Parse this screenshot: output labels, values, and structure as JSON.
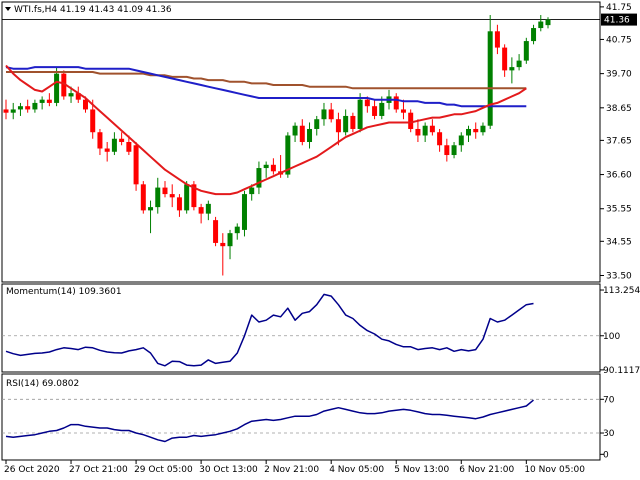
{
  "symbol_header": "WTI.fs,H4  41.19 41.43 41.09 41.36",
  "current_price_label": "41.36",
  "colors": {
    "bull": "#008000",
    "bear": "#ff0000",
    "ma_fast": "#e31a1c",
    "ma_mid": "#1f1fc8",
    "ma_slow": "#a0522d",
    "indicator_line": "#00008b",
    "price_tag_bg": "#000000"
  },
  "momentum": {
    "label": "Momentum(14) 109.3601",
    "axis_labels": [
      "113.2541",
      "100",
      "90.1117"
    ]
  },
  "rsi": {
    "label": "RSI(14) 69.0802",
    "axis_labels": [
      "70",
      "30",
      "0"
    ]
  },
  "price_axis_labels": [
    "41.75",
    "40.75",
    "39.70",
    "38.65",
    "37.65",
    "36.60",
    "35.55",
    "34.55",
    "33.50"
  ],
  "time_axis_labels": [
    "26 Oct 2020",
    "27 Oct 21:00",
    "29 Oct 05:00",
    "30 Oct 13:00",
    "2 Nov 21:00",
    "4 Nov 05:00",
    "5 Nov 13:00",
    "6 Nov 21:00",
    "10 Nov 05:00"
  ],
  "chart_data": [
    {
      "type": "candlestick",
      "ylim": [
        33.3,
        41.9
      ],
      "candles": [
        {
          "o": 38.6,
          "h": 38.9,
          "l": 38.3,
          "c": 38.5
        },
        {
          "o": 38.5,
          "h": 38.8,
          "l": 38.3,
          "c": 38.6
        },
        {
          "o": 38.6,
          "h": 38.8,
          "l": 38.4,
          "c": 38.7
        },
        {
          "o": 38.7,
          "h": 38.9,
          "l": 38.5,
          "c": 38.6
        },
        {
          "o": 38.6,
          "h": 38.9,
          "l": 38.5,
          "c": 38.8
        },
        {
          "o": 38.8,
          "h": 39.0,
          "l": 38.6,
          "c": 38.9
        },
        {
          "o": 38.9,
          "h": 39.1,
          "l": 38.7,
          "c": 38.8
        },
        {
          "o": 38.8,
          "h": 39.9,
          "l": 38.7,
          "c": 39.7
        },
        {
          "o": 39.7,
          "h": 39.8,
          "l": 38.9,
          "c": 39.0
        },
        {
          "o": 39.0,
          "h": 39.3,
          "l": 38.8,
          "c": 39.1
        },
        {
          "o": 39.1,
          "h": 39.3,
          "l": 38.8,
          "c": 38.9
        },
        {
          "o": 38.9,
          "h": 39.0,
          "l": 38.5,
          "c": 38.6
        },
        {
          "o": 38.6,
          "h": 38.9,
          "l": 37.7,
          "c": 37.9
        },
        {
          "o": 37.9,
          "h": 38.0,
          "l": 37.2,
          "c": 37.4
        },
        {
          "o": 37.4,
          "h": 37.6,
          "l": 37.0,
          "c": 37.3
        },
        {
          "o": 37.3,
          "h": 37.9,
          "l": 37.2,
          "c": 37.7
        },
        {
          "o": 37.7,
          "h": 37.9,
          "l": 37.5,
          "c": 37.6
        },
        {
          "o": 37.6,
          "h": 37.8,
          "l": 37.2,
          "c": 37.3
        },
        {
          "o": 37.5,
          "h": 37.6,
          "l": 36.1,
          "c": 36.3
        },
        {
          "o": 36.3,
          "h": 36.4,
          "l": 35.4,
          "c": 35.5
        },
        {
          "o": 35.5,
          "h": 35.8,
          "l": 34.8,
          "c": 35.6
        },
        {
          "o": 35.6,
          "h": 36.5,
          "l": 35.4,
          "c": 36.2
        },
        {
          "o": 36.2,
          "h": 36.4,
          "l": 35.9,
          "c": 36.0
        },
        {
          "o": 36.0,
          "h": 36.3,
          "l": 35.6,
          "c": 35.9
        },
        {
          "o": 35.9,
          "h": 36.0,
          "l": 35.3,
          "c": 35.5
        },
        {
          "o": 35.5,
          "h": 36.4,
          "l": 35.4,
          "c": 36.3
        },
        {
          "o": 36.3,
          "h": 36.4,
          "l": 35.5,
          "c": 35.6
        },
        {
          "o": 35.6,
          "h": 35.7,
          "l": 35.1,
          "c": 35.4
        },
        {
          "o": 35.4,
          "h": 35.8,
          "l": 35.2,
          "c": 35.7
        },
        {
          "o": 35.2,
          "h": 35.3,
          "l": 34.4,
          "c": 34.5
        },
        {
          "o": 34.5,
          "h": 34.8,
          "l": 33.5,
          "c": 34.4
        },
        {
          "o": 34.4,
          "h": 34.9,
          "l": 34.0,
          "c": 34.8
        },
        {
          "o": 34.8,
          "h": 35.1,
          "l": 34.6,
          "c": 35.0
        },
        {
          "o": 34.9,
          "h": 36.1,
          "l": 34.7,
          "c": 36.0
        },
        {
          "o": 36.0,
          "h": 36.3,
          "l": 35.8,
          "c": 36.2
        },
        {
          "o": 36.2,
          "h": 37.0,
          "l": 36.0,
          "c": 36.8
        },
        {
          "o": 36.8,
          "h": 37.0,
          "l": 36.5,
          "c": 36.9
        },
        {
          "o": 36.9,
          "h": 37.1,
          "l": 36.6,
          "c": 36.7
        },
        {
          "o": 36.7,
          "h": 37.2,
          "l": 36.5,
          "c": 36.6
        },
        {
          "o": 36.6,
          "h": 37.9,
          "l": 36.5,
          "c": 37.8
        },
        {
          "o": 37.8,
          "h": 38.2,
          "l": 37.6,
          "c": 38.1
        },
        {
          "o": 38.1,
          "h": 38.3,
          "l": 37.5,
          "c": 37.6
        },
        {
          "o": 37.6,
          "h": 38.2,
          "l": 37.4,
          "c": 38.0
        },
        {
          "o": 38.0,
          "h": 38.4,
          "l": 37.8,
          "c": 38.3
        },
        {
          "o": 38.3,
          "h": 38.8,
          "l": 38.1,
          "c": 38.6
        },
        {
          "o": 38.6,
          "h": 38.8,
          "l": 38.2,
          "c": 38.3
        },
        {
          "o": 38.3,
          "h": 38.5,
          "l": 37.5,
          "c": 37.9
        },
        {
          "o": 37.9,
          "h": 38.6,
          "l": 37.8,
          "c": 38.4
        },
        {
          "o": 38.4,
          "h": 38.5,
          "l": 37.9,
          "c": 38.0
        },
        {
          "o": 38.0,
          "h": 39.1,
          "l": 37.9,
          "c": 38.9
        },
        {
          "o": 38.9,
          "h": 39.0,
          "l": 38.5,
          "c": 38.7
        },
        {
          "o": 38.7,
          "h": 38.9,
          "l": 38.3,
          "c": 38.4
        },
        {
          "o": 38.4,
          "h": 39.0,
          "l": 38.3,
          "c": 38.8
        },
        {
          "o": 38.8,
          "h": 39.2,
          "l": 38.6,
          "c": 39.0
        },
        {
          "o": 39.0,
          "h": 39.1,
          "l": 38.5,
          "c": 38.6
        },
        {
          "o": 38.6,
          "h": 38.9,
          "l": 38.3,
          "c": 38.5
        },
        {
          "o": 38.5,
          "h": 38.6,
          "l": 37.9,
          "c": 38.0
        },
        {
          "o": 38.0,
          "h": 38.3,
          "l": 37.6,
          "c": 37.8
        },
        {
          "o": 37.8,
          "h": 38.2,
          "l": 37.6,
          "c": 38.1
        },
        {
          "o": 38.1,
          "h": 38.3,
          "l": 37.8,
          "c": 37.9
        },
        {
          "o": 37.9,
          "h": 38.0,
          "l": 37.3,
          "c": 37.5
        },
        {
          "o": 37.5,
          "h": 37.7,
          "l": 37.0,
          "c": 37.2
        },
        {
          "o": 37.2,
          "h": 37.6,
          "l": 37.1,
          "c": 37.5
        },
        {
          "o": 37.5,
          "h": 37.9,
          "l": 37.3,
          "c": 37.8
        },
        {
          "o": 37.8,
          "h": 38.1,
          "l": 37.6,
          "c": 38.0
        },
        {
          "o": 38.0,
          "h": 38.2,
          "l": 37.7,
          "c": 37.9
        },
        {
          "o": 37.9,
          "h": 38.2,
          "l": 37.8,
          "c": 38.1
        },
        {
          "o": 38.1,
          "h": 41.5,
          "l": 38.0,
          "c": 41.0
        },
        {
          "o": 41.0,
          "h": 41.2,
          "l": 40.3,
          "c": 40.5
        },
        {
          "o": 40.5,
          "h": 40.6,
          "l": 39.6,
          "c": 39.8
        },
        {
          "o": 39.8,
          "h": 40.2,
          "l": 39.4,
          "c": 39.9
        },
        {
          "o": 39.9,
          "h": 40.3,
          "l": 39.8,
          "c": 40.1
        },
        {
          "o": 40.1,
          "h": 40.8,
          "l": 40.0,
          "c": 40.7
        },
        {
          "o": 40.7,
          "h": 41.2,
          "l": 40.6,
          "c": 41.1
        },
        {
          "o": 41.1,
          "h": 41.5,
          "l": 41.0,
          "c": 41.3
        },
        {
          "o": 41.19,
          "h": 41.43,
          "l": 41.09,
          "c": 41.36
        }
      ],
      "ma_fast": [
        39.95,
        39.7,
        39.5,
        39.35,
        39.2,
        39.15,
        39.3,
        39.45,
        39.4,
        39.25,
        39.1,
        38.95,
        38.75,
        38.55,
        38.35,
        38.15,
        37.95,
        37.75,
        37.55,
        37.35,
        37.15,
        36.95,
        36.75,
        36.6,
        36.45,
        36.3,
        36.2,
        36.1,
        36.05,
        36.0,
        36.0,
        36.0,
        36.05,
        36.15,
        36.25,
        36.35,
        36.45,
        36.55,
        36.65,
        36.75,
        36.85,
        36.95,
        37.05,
        37.15,
        37.3,
        37.45,
        37.6,
        37.75,
        37.85,
        37.95,
        38.05,
        38.1,
        38.15,
        38.2,
        38.2,
        38.2,
        38.2,
        38.25,
        38.3,
        38.35,
        38.35,
        38.4,
        38.45,
        38.45,
        38.5,
        38.55,
        38.65,
        38.75,
        38.8,
        38.9,
        39.0,
        39.1,
        39.25
      ],
      "ma_mid": [
        39.9,
        39.85,
        39.85,
        39.85,
        39.9,
        39.9,
        39.9,
        39.9,
        39.9,
        39.9,
        39.9,
        39.85,
        39.85,
        39.85,
        39.85,
        39.85,
        39.85,
        39.85,
        39.8,
        39.75,
        39.7,
        39.65,
        39.6,
        39.55,
        39.5,
        39.45,
        39.4,
        39.35,
        39.3,
        39.25,
        39.2,
        39.15,
        39.1,
        39.05,
        39.0,
        38.95,
        38.95,
        38.95,
        38.95,
        38.95,
        38.95,
        38.95,
        38.95,
        38.95,
        38.95,
        38.95,
        38.95,
        38.95,
        38.95,
        38.95,
        38.95,
        38.9,
        38.9,
        38.9,
        38.9,
        38.85,
        38.85,
        38.85,
        38.8,
        38.8,
        38.8,
        38.75,
        38.75,
        38.7,
        38.7,
        38.7,
        38.7,
        38.7,
        38.7,
        38.7,
        38.7,
        38.7,
        38.7
      ],
      "ma_slow": [
        39.75,
        39.75,
        39.75,
        39.75,
        39.75,
        39.75,
        39.75,
        39.75,
        39.75,
        39.75,
        39.75,
        39.75,
        39.75,
        39.7,
        39.7,
        39.7,
        39.7,
        39.7,
        39.7,
        39.7,
        39.65,
        39.65,
        39.65,
        39.6,
        39.6,
        39.6,
        39.55,
        39.55,
        39.5,
        39.5,
        39.5,
        39.45,
        39.45,
        39.45,
        39.4,
        39.4,
        39.4,
        39.35,
        39.35,
        39.35,
        39.35,
        39.35,
        39.3,
        39.3,
        39.3,
        39.3,
        39.3,
        39.3,
        39.25,
        39.25,
        39.25,
        39.25,
        39.25,
        39.25,
        39.25,
        39.25,
        39.25,
        39.25,
        39.25,
        39.25,
        39.25,
        39.25,
        39.25,
        39.25,
        39.25,
        39.25,
        39.25,
        39.25,
        39.25,
        39.25,
        39.25,
        39.25,
        39.25
      ]
    },
    {
      "type": "line",
      "title": "Momentum(14) 109.3601",
      "ylim": [
        89.5,
        115
      ],
      "values": [
        95.5,
        94.8,
        94.3,
        94.6,
        94.9,
        95.0,
        95.3,
        96.0,
        96.5,
        96.3,
        96.0,
        96.7,
        96.5,
        95.8,
        95.3,
        95.1,
        95.0,
        95.6,
        96.0,
        96.5,
        95.0,
        92.0,
        91.3,
        92.6,
        92.5,
        91.5,
        91.3,
        91.5,
        93.0,
        92.0,
        92.3,
        92.6,
        95.0,
        100.0,
        106.0,
        104.0,
        104.5,
        106.0,
        105.5,
        108.0,
        104.5,
        106.5,
        107.0,
        109.0,
        112.0,
        111.5,
        109.0,
        106.0,
        105.0,
        103.0,
        101.5,
        100.5,
        99.0,
        98.5,
        97.5,
        96.8,
        96.8,
        96.0,
        96.3,
        96.5,
        96.0,
        96.5,
        95.5,
        96.0,
        95.6,
        96.0,
        99.0,
        105.0,
        104.0,
        104.5,
        106.0,
        107.5,
        109.0,
        109.36
      ]
    },
    {
      "type": "line",
      "title": "RSI(14) 69.0802",
      "ylim": [
        -2,
        100
      ],
      "values": [
        26,
        25,
        26,
        27,
        28,
        30,
        32,
        33,
        36,
        40,
        40,
        38,
        37,
        36,
        36,
        34,
        33,
        33,
        30,
        28,
        25,
        22,
        20,
        24,
        25,
        25,
        27,
        26,
        27,
        28,
        30,
        32,
        35,
        40,
        44,
        45,
        46,
        45,
        46,
        48,
        50,
        50,
        50,
        52,
        56,
        58,
        60,
        58,
        56,
        54,
        53,
        53,
        54,
        56,
        57,
        58,
        57,
        55,
        53,
        52,
        52,
        51,
        50,
        49,
        48,
        47,
        49,
        52,
        54,
        56,
        58,
        60,
        62,
        69.08
      ]
    }
  ]
}
